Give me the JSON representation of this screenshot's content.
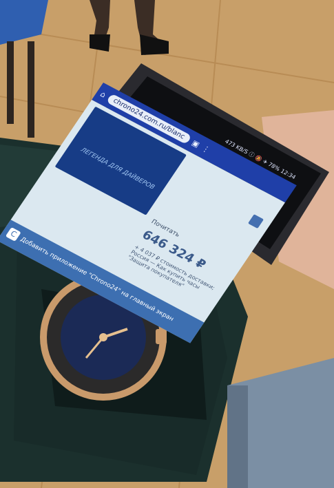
{
  "phone": {
    "status_bar": "473 KB/S ⓘ 🔕 ✈ 78% 12:34",
    "url": "chrono24.com.ru/blanc",
    "hero_caption": "ЛЕГЕНДА ДЛЯ ДАЙВЕРОВ",
    "availability_label": "Почитать",
    "price": "646 324 ₽",
    "price_note": "+ 4 037 ₽ стоимость доставки; Россия — Как купить часы \"Защита покупателя\"",
    "banner_text": "Добавить приложение \"Chrono24\" на главный экран",
    "banner_icon": "C"
  },
  "scene": {
    "description_colors": {
      "floor": "#c9a16b",
      "case": "#1e3431",
      "screen": "#cfe3ee",
      "url_bar": "#1f3fa8",
      "watch_dial": "#1b2a56",
      "watch_bezel": "#2b2a2a",
      "watch_gold": "#c99a6b",
      "sleeve": "#7c8ea0"
    }
  }
}
